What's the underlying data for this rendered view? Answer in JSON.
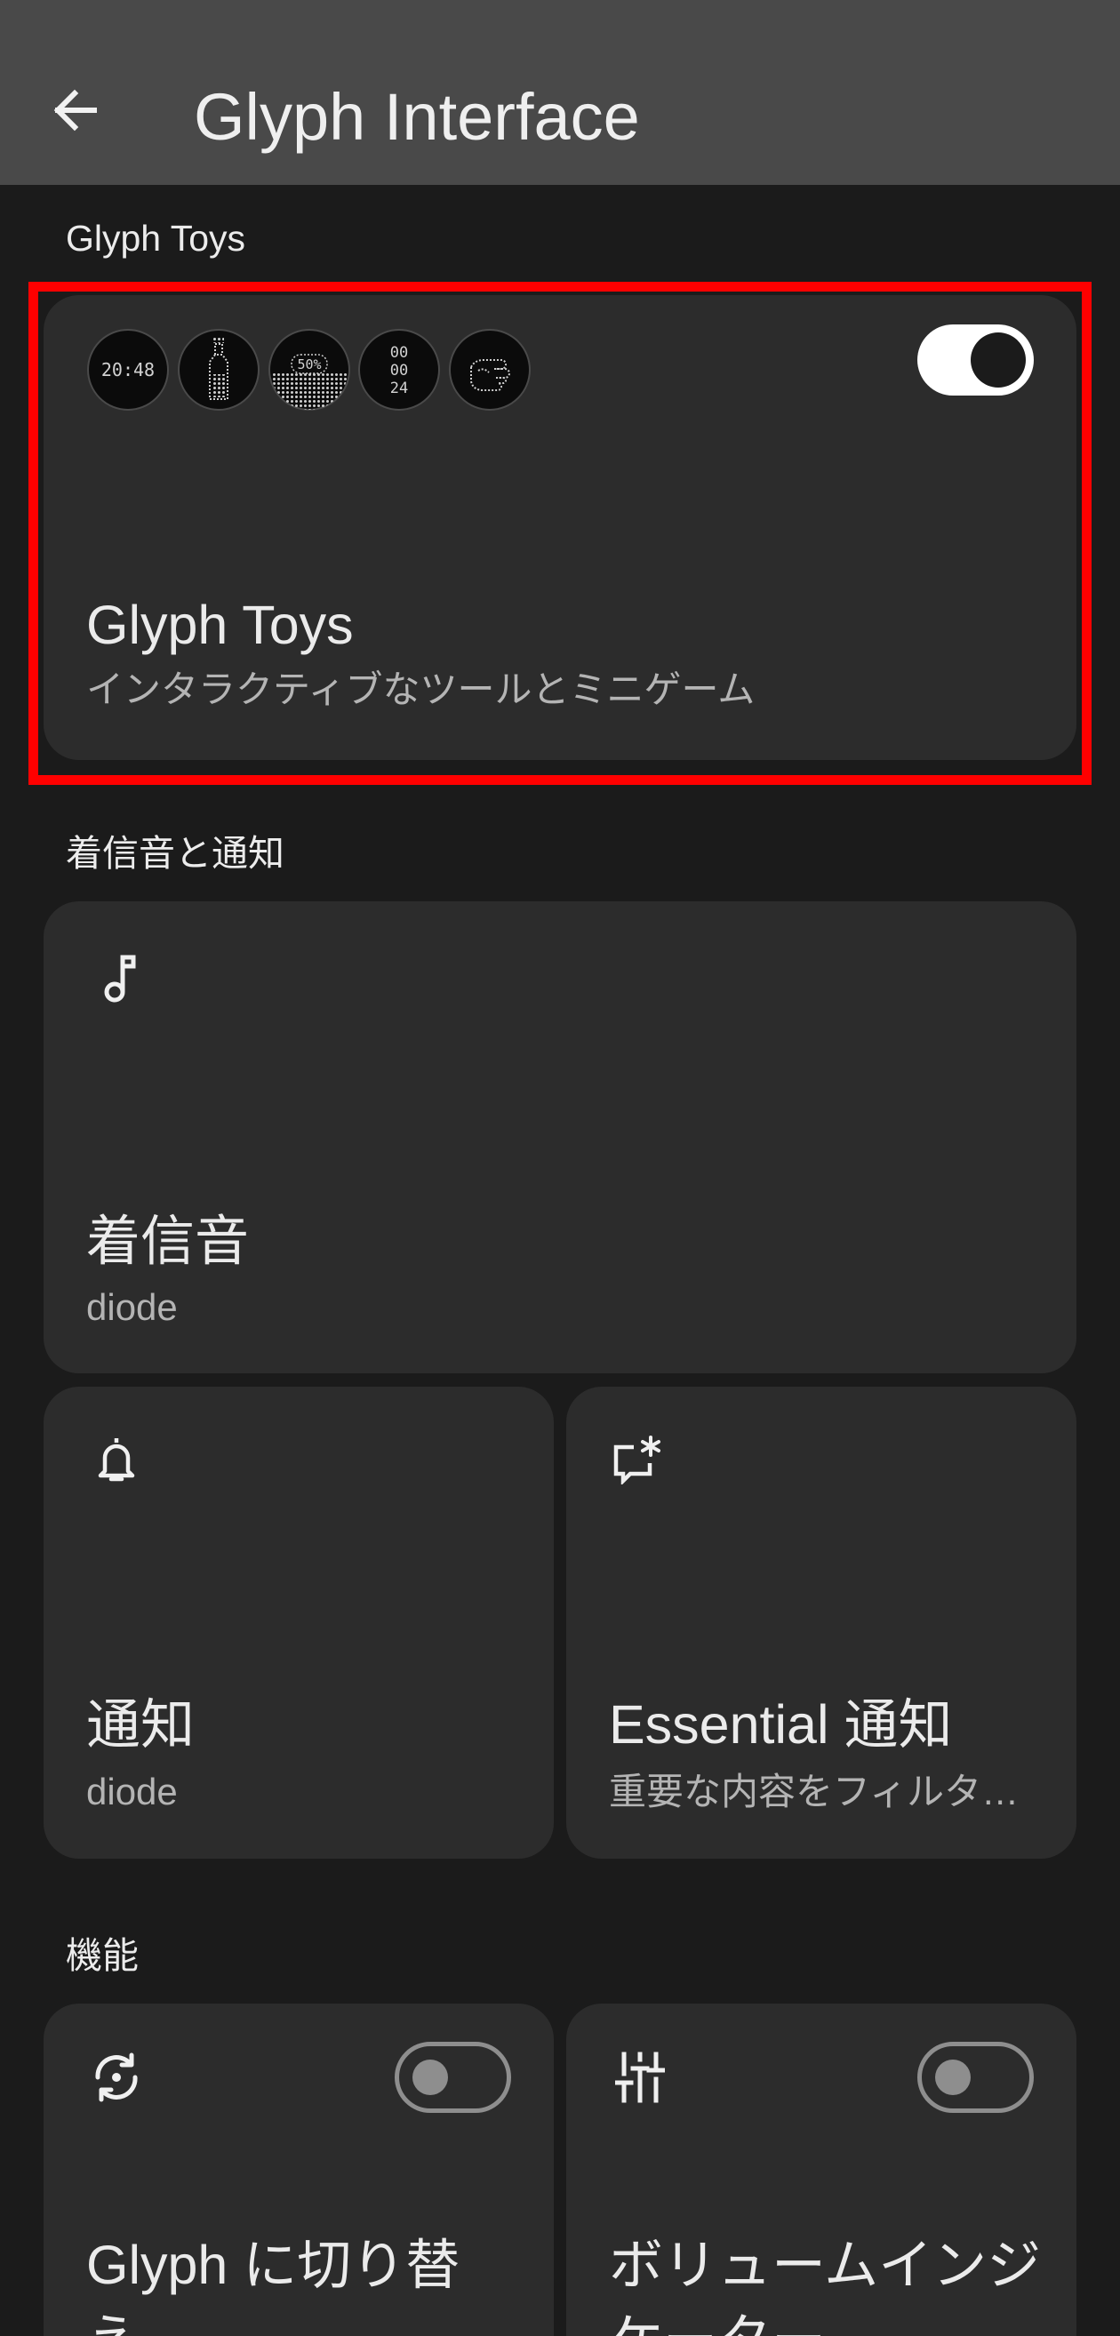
{
  "header": {
    "back_icon": "arrow-back-icon",
    "title": "Glyph Interface"
  },
  "glyph_toys": {
    "section_label": "Glyph Toys",
    "card": {
      "title": "Glyph Toys",
      "subtitle": "インタラクティブなツールとミニゲーム",
      "enabled": true,
      "toys": [
        {
          "icon": "clock-toy-icon",
          "text": "20:48"
        },
        {
          "icon": "bottle-toy-icon"
        },
        {
          "icon": "battery-toy-icon",
          "text": "50%"
        },
        {
          "icon": "timer-toy-icon",
          "lines": [
            "00",
            "00",
            "24"
          ]
        },
        {
          "icon": "fist-toy-icon"
        }
      ]
    }
  },
  "ringtones_notifications": {
    "section_label": "着信音と通知",
    "ringtone": {
      "icon": "music-note-icon",
      "title": "着信音",
      "value": "diode"
    },
    "notifications": {
      "icon": "bell-icon",
      "title": "通知",
      "value": "diode"
    },
    "essential_notifications": {
      "icon": "essential-notification-icon",
      "title": "Essential 通知",
      "subtitle": "重要な内容をフィルタ…"
    }
  },
  "features": {
    "section_label": "機能",
    "items": [
      {
        "icon": "flip-rotate-icon",
        "title": "Glyph に切り替え",
        "enabled": false
      },
      {
        "icon": "sliders-icon",
        "title": "ボリュームインジケーター",
        "enabled": false
      }
    ]
  },
  "colors": {
    "top_bar": "#494949",
    "background": "#1b1b1b",
    "card": "#2c2c2c",
    "text": "#ececec",
    "subtext": "#b4b4b4",
    "toggle_on_track": "#ffffff",
    "toggle_on_knob": "#1b1b1b",
    "toggle_off": "#8e8e8e",
    "highlight": "#ff0000"
  }
}
